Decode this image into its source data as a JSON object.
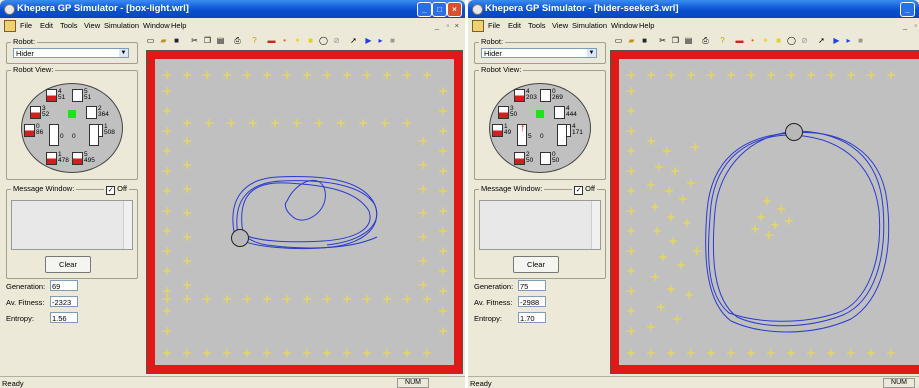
{
  "windows": [
    {
      "title": "Khepera GP Simulator - [box-light.wrl]",
      "menu": [
        "File",
        "Edit",
        "Tools",
        "View",
        "Simulation",
        "Window",
        "Help"
      ],
      "robot_label": "Robot:",
      "robot_value": "Hider",
      "robot_view_label": "Robot View:",
      "sensors": [
        {
          "id": "4",
          "value": "51"
        },
        {
          "id": "5",
          "value": "51"
        },
        {
          "id": "3",
          "value": "52"
        },
        {
          "id": "2",
          "value": "364"
        },
        {
          "id": "0",
          "value": "86"
        },
        {
          "id": "1",
          "value": "508"
        },
        {
          "id": "1",
          "value": "478"
        },
        {
          "id": "5",
          "value": "495"
        }
      ],
      "wheel_left": "0",
      "wheel_right": "0",
      "message_window_label": "Message Window:",
      "off_label": "Off",
      "clear_label": "Clear",
      "generation_label": "Generation:",
      "generation": "69",
      "fitness_label": "Av. Fitness:",
      "fitness": "-2323",
      "entropy_label": "Entropy:",
      "entropy": "1.56",
      "status": "Ready",
      "num": "NUM"
    },
    {
      "title": "Khepera GP Simulator - [hider-seeker3.wrl]",
      "menu": [
        "File",
        "Edit",
        "Tools",
        "View",
        "Simulation",
        "Window",
        "Help"
      ],
      "robot_label": "Robot:",
      "robot_value": "Hider",
      "robot_view_label": "Robot View:",
      "sensors": [
        {
          "id": "4",
          "value": "203"
        },
        {
          "id": "0",
          "value": "269"
        },
        {
          "id": "3",
          "value": "50"
        },
        {
          "id": "4",
          "value": "444"
        },
        {
          "id": "1",
          "value": "49"
        },
        {
          "id": "4",
          "value": "171"
        },
        {
          "id": "2",
          "value": "50"
        },
        {
          "id": "0",
          "value": "50"
        }
      ],
      "wheel_left": "5",
      "wheel_right": "0",
      "message_window_label": "Message Window:",
      "off_label": "Off",
      "clear_label": "Clear",
      "generation_label": "Generation:",
      "generation": "75",
      "fitness_label": "Av. Fitness:",
      "fitness": "-2988",
      "entropy_label": "Entropy:",
      "entropy": "1.70",
      "status": "Ready",
      "num": "NUM"
    }
  ],
  "colors": {
    "titlebar": "#0a4fd0",
    "wall": "#e01818",
    "arena": "#c0c0c0",
    "light": "#f0e040",
    "trajectory": "#2a3ad0"
  },
  "icons": [
    "app-icon",
    "minimize-icon",
    "maximize-icon",
    "close-icon",
    "new-icon",
    "open-icon",
    "save-icon",
    "cut-icon",
    "copy-icon",
    "paste-icon",
    "print-icon",
    "help-icon",
    "wall-tool-icon",
    "light-tool-icon",
    "box-tool-icon",
    "robot-tool-icon",
    "select-icon",
    "run-icon",
    "step-icon",
    "stop-icon"
  ]
}
